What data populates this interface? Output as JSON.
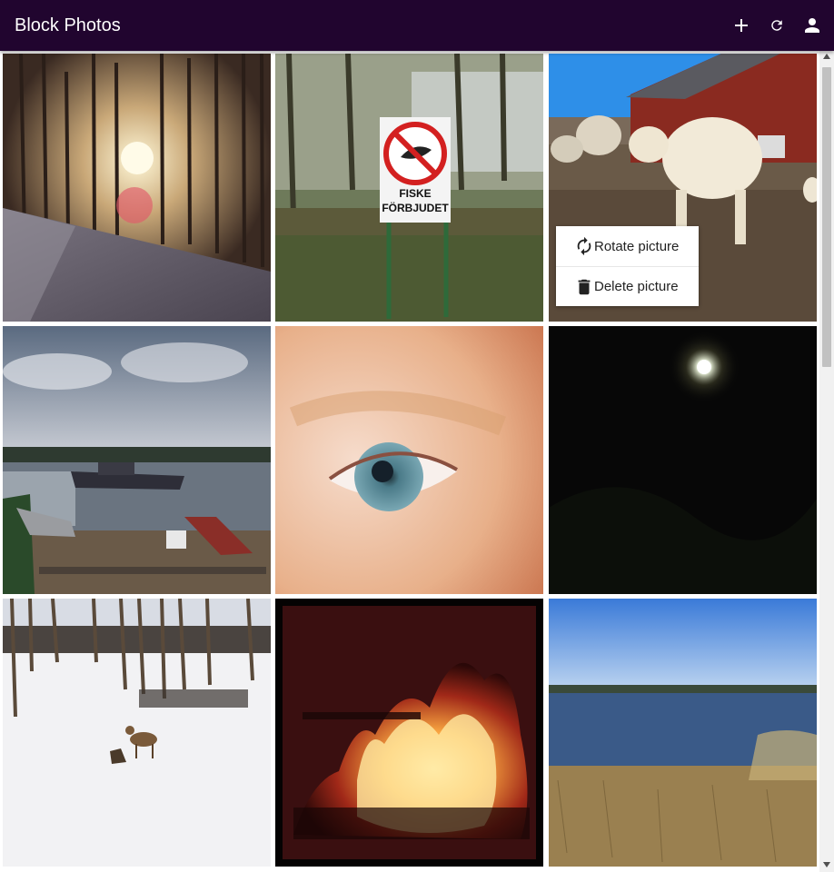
{
  "app": {
    "title": "Block Photos",
    "brand_color": "#21052f"
  },
  "toolbar": {
    "actions": [
      {
        "name": "add",
        "icon": "plus-icon"
      },
      {
        "name": "refresh",
        "icon": "refresh-icon"
      },
      {
        "name": "account",
        "icon": "person-icon"
      }
    ]
  },
  "gallery": {
    "photos": [
      {
        "subject": "sunlight-through-forest-road"
      },
      {
        "subject": "no-fishing-sign"
      },
      {
        "subject": "white-cattle-at-barn"
      },
      {
        "subject": "harbor-with-ship"
      },
      {
        "subject": "close-up-eye"
      },
      {
        "subject": "moon-at-night"
      },
      {
        "subject": "deer-in-snow"
      },
      {
        "subject": "fireplace-flames"
      },
      {
        "subject": "lake-shore"
      }
    ],
    "sign_text_line1": "FISKE",
    "sign_text_line2": "FÖRBJUDET"
  },
  "context_menu": {
    "items": [
      {
        "label": "Rotate picture",
        "icon": "rotate-icon"
      },
      {
        "label": "Delete picture",
        "icon": "trash-icon"
      }
    ]
  }
}
